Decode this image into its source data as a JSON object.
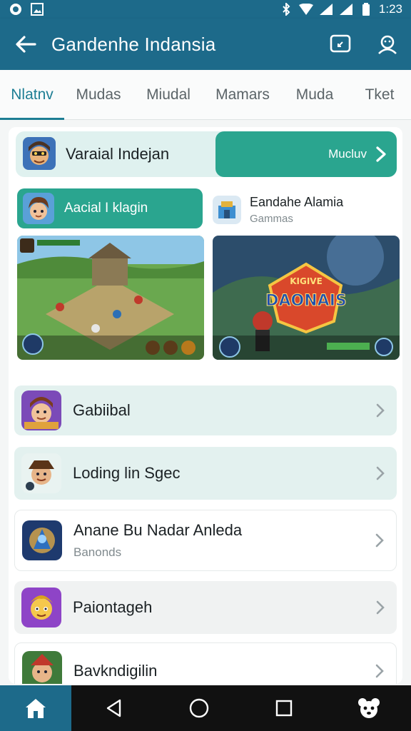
{
  "status_bar": {
    "time": "1:23"
  },
  "app_bar": {
    "title": "Gandenhe Indansia"
  },
  "tabs": [
    {
      "label": "Nlatnv",
      "active": true
    },
    {
      "label": "Mudas",
      "active": false
    },
    {
      "label": "Miudal",
      "active": false
    },
    {
      "label": "Mamars",
      "active": false
    },
    {
      "label": "Muda",
      "active": false
    },
    {
      "label": "Tket",
      "active": false
    }
  ],
  "hero": {
    "label": "Varaial Indejan",
    "cta_label": "Mucluv"
  },
  "pill": {
    "label": "Aacial I klagin"
  },
  "mini": {
    "title": "Eandahe Alamia",
    "subtitle": "Gammas"
  },
  "screenshot_b": {
    "logo_top": "KIGIVE",
    "logo_main": "DAONAIS"
  },
  "list": [
    {
      "name": "Gabiibal",
      "subtitle": ""
    },
    {
      "name": "Loding lin Sgec",
      "subtitle": ""
    },
    {
      "name": "Anane Bu Nadar Anleda",
      "subtitle": "Banonds"
    },
    {
      "name": "Paiontageh",
      "subtitle": ""
    },
    {
      "name": "Bavkndigilin",
      "subtitle": ""
    }
  ],
  "colors": {
    "primary": "#1d6a8a",
    "accent": "#2aa58f",
    "tint": "#e3f1ef"
  },
  "icons": [
    "whatsapp-icon",
    "gallery-icon",
    "bluetooth-icon",
    "wifi-icon",
    "signal-icon",
    "back-arrow-icon",
    "chat-icon",
    "profile-icon",
    "chevron-right-icon",
    "home-icon",
    "nav-back-icon",
    "nav-home-icon",
    "nav-recents-icon",
    "bear-icon"
  ]
}
